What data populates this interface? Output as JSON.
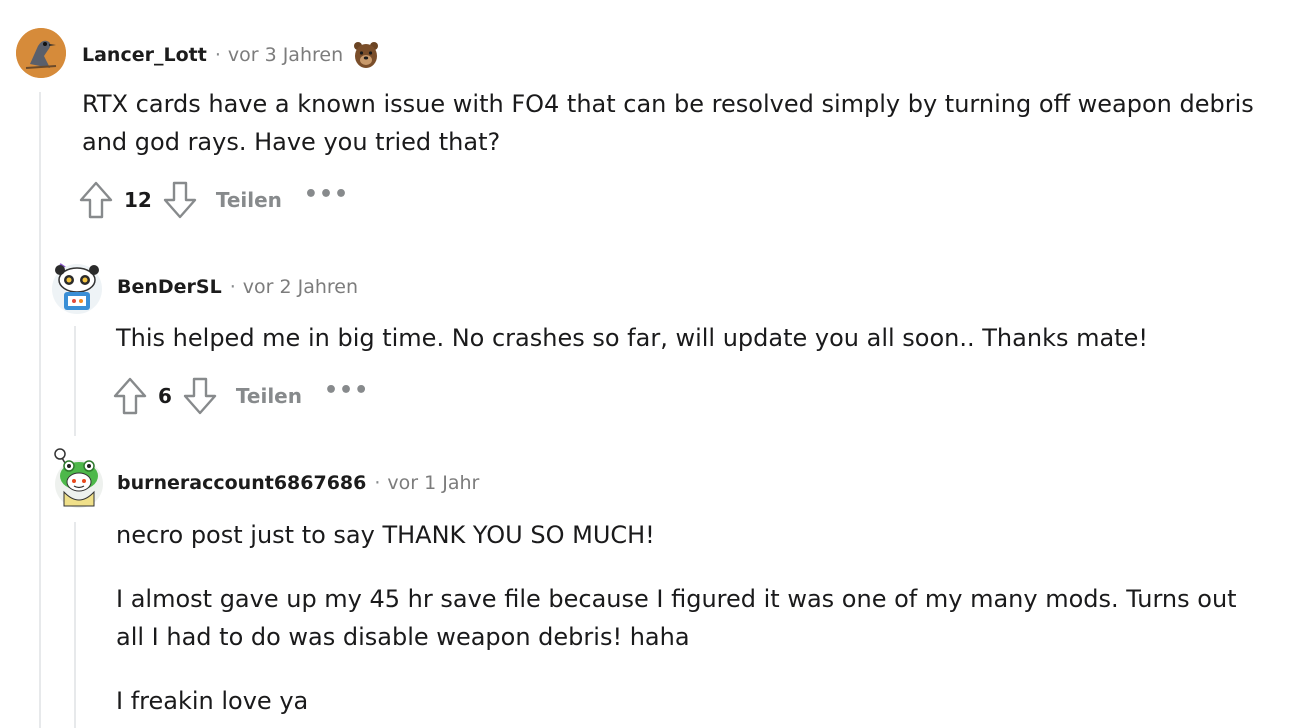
{
  "comments": [
    {
      "author": "Lancer_Lott",
      "separator": "·",
      "time": "vor 3 Jahren",
      "flair_icon": "bear-emoji-icon",
      "lines": [
        "RTX cards have a known issue with FO4 that can be resolved simply by turning off weapon debris",
        "and god rays. Have you tried that?"
      ],
      "score": "12",
      "share_label": "Teilen",
      "more_label": "•••"
    },
    {
      "author": "BenDerSL",
      "separator": "·",
      "time": "vor 2 Jahren",
      "lines": [
        "This helped me in big time. No crashes so far, will update you all soon.. Thanks mate!"
      ],
      "score": "6",
      "share_label": "Teilen",
      "more_label": "•••"
    },
    {
      "author": "burneraccount6867686",
      "separator": "·",
      "time": "vor 1 Jahr",
      "paragraphs": [
        "necro post just to say THANK YOU SO MUCH!",
        "I almost gave up my 45 hr save file because I figured it was one of my many mods. Turns out",
        "all I had to do was disable weapon debris! haha",
        "I freakin love ya"
      ]
    }
  ],
  "colors": {
    "thread_line": "#e7e9eb",
    "meta_gray": "#7c7c7c",
    "action_gray": "#878a8c"
  }
}
